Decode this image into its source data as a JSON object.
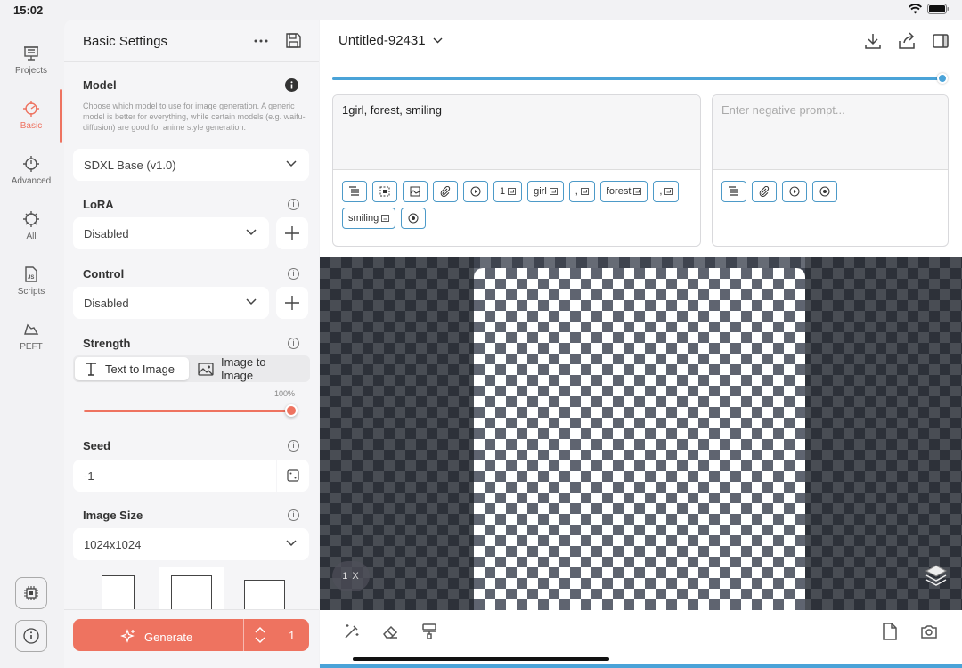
{
  "status": {
    "time": "15:02"
  },
  "rail": {
    "items": [
      {
        "label": "Projects",
        "icon": "projects-icon"
      },
      {
        "label": "Basic",
        "icon": "basic-icon",
        "active": true
      },
      {
        "label": "Advanced",
        "icon": "advanced-icon"
      },
      {
        "label": "All",
        "icon": "all-icon"
      },
      {
        "label": "Scripts",
        "icon": "scripts-icon"
      },
      {
        "label": "PEFT",
        "icon": "peft-icon"
      }
    ]
  },
  "panel": {
    "title": "Basic Settings",
    "model": {
      "label": "Model",
      "description": "Choose which model to use for image generation. A generic model is better for everything, while certain models (e.g. waifu-diffusion) are good for anime style generation.",
      "value": "SDXL Base (v1.0)"
    },
    "lora": {
      "label": "LoRA",
      "value": "Disabled"
    },
    "control": {
      "label": "Control",
      "value": "Disabled"
    },
    "strength": {
      "label": "Strength",
      "mode_txt2img": "Text to Image",
      "mode_img2img": "Image to Image",
      "selected": "Text to Image",
      "percent": "100%",
      "value": 1.0
    },
    "seed": {
      "label": "Seed",
      "value": "-1"
    },
    "image_size": {
      "label": "Image Size",
      "value": "1024x1024"
    },
    "generate": {
      "label": "Generate",
      "count": "1"
    }
  },
  "main": {
    "doc_title": "Untitled-92431",
    "progress": 1.0,
    "prompt": {
      "value": "1girl, forest, smiling"
    },
    "negative": {
      "placeholder": "Enter negative prompt...",
      "value": ""
    },
    "prompt_chips": [
      "1",
      "girl",
      ",",
      "forest",
      ",",
      "smiling"
    ],
    "zoom": "1 X"
  },
  "colors": {
    "accent": "#ee7360",
    "blue": "#4aa3d8"
  }
}
